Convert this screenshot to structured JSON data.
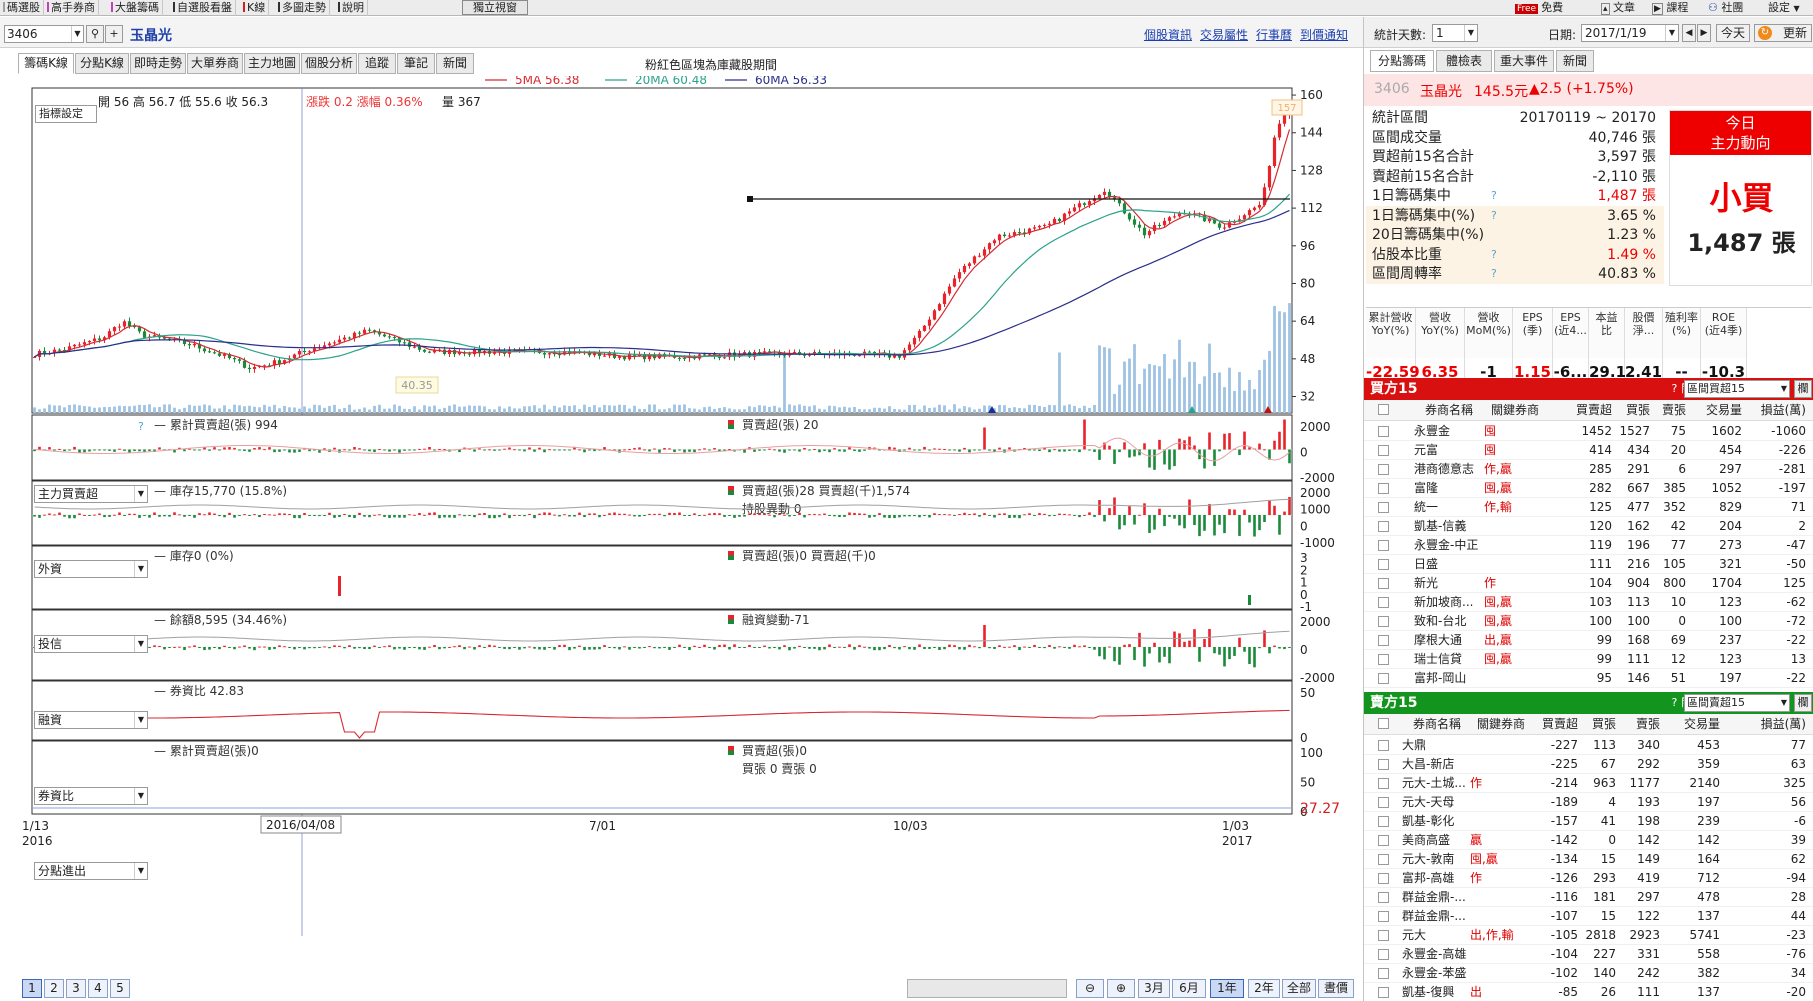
{
  "colors": {
    "up": "#e8232a",
    "down": "#1a8a3a",
    "vol": "#9ec3e3",
    "ma5": "#d62a32",
    "ma20": "#2aa38a",
    "ma60": "#2a2f8a",
    "buyHeader": "#d81010",
    "sellHeader": "#12941e",
    "netLine": "#e8a0a0",
    "invLine": "#a0a0a0"
  },
  "topbar": {
    "items": [
      {
        "label": "碼選股",
        "mark": "#a0a0a0"
      },
      {
        "label": "高手券商",
        "mark": "#c040c0"
      },
      {
        "label": "大盤籌碼",
        "mark": "#c040c0"
      },
      {
        "label": "自選股看盤",
        "mark": "#303030"
      },
      {
        "label": "K線",
        "mark": "#d02020"
      },
      {
        "label": "多圖走勢",
        "mark": "#303030"
      },
      {
        "label": "說明",
        "mark": "#303030"
      }
    ],
    "independent": "獨立視窗",
    "free_badge": "Free",
    "free": "免費",
    "article": "文章",
    "course": "課程",
    "community": "社團",
    "settings": "設定"
  },
  "stock": {
    "code": "3406",
    "name": "玉晶光"
  },
  "links": [
    "個股資訊",
    "交易屬性",
    "行事曆",
    "到價通知"
  ],
  "tabs": [
    "籌碼K線",
    "分點K線",
    "即時走勢",
    "大單券商",
    "主力地圖",
    "個股分析",
    "追蹤",
    "筆記",
    "新聞"
  ],
  "note": "粉紅色區塊為庫藏股期間",
  "legend": {
    "ma5": "5MA 56.38",
    "ma20": "20MA 60.48",
    "ma60": "60MA 56.33"
  },
  "info": {
    "button": "指標設定",
    "ohlc": "開 56  高 56.7  低 55.6  收 56.3",
    "change": "漲跌 0.2  漲幅  0.36%",
    "vol": "量 367",
    "low_marker": "40.35",
    "high_marker": "157"
  },
  "kchart": {
    "yticks": [
      "160",
      "144",
      "128",
      "112",
      "96",
      "80",
      "64",
      "48",
      "32"
    ],
    "priceMin": 25,
    "priceMax": 163,
    "volMax": 1.0
  },
  "panels": [
    {
      "select": "主力買賣超",
      "left": "累計買賣超(張) 994",
      "mid": "買賣超(張) 20",
      "mid2": "",
      "axis": [
        "2000",
        "0",
        "-2000"
      ],
      "kind": "net",
      "line": "#e8a0a0"
    },
    {
      "select": "外資",
      "left": "庫存15,770 (15.8%)",
      "mid": "買賣超(張)28 買賣超(千)1,574",
      "mid2": "持股異動 0",
      "axis": [
        "2000",
        "1000",
        "0",
        "-1000"
      ],
      "kind": "foreign",
      "line": "#a0a0a0"
    },
    {
      "select": "投信",
      "left": "庫存0 (0%)",
      "mid": "買賣超(張)0 買賣超(千)0",
      "mid2": "",
      "axis": [
        "3",
        "2",
        "1",
        "0",
        "-1"
      ],
      "kind": "trust",
      "line": ""
    },
    {
      "select": "融資",
      "left": "餘額8,595 (34.46%)",
      "mid": "融資變動-71",
      "mid2": "",
      "axis": [
        "2000",
        "0",
        "-2000"
      ],
      "kind": "margin",
      "line": "#a0a0a0"
    },
    {
      "select": "券資比",
      "left": "券資比 42.83",
      "mid": "",
      "mid2": "",
      "axis": [
        "50",
        "0"
      ],
      "kind": "ratio",
      "line": "#d62a32"
    },
    {
      "select": "分點進出",
      "left": "累計買賣超(張)0",
      "mid": "買賣超(張)0",
      "mid2": "買張 0 賣張 0",
      "axis": [
        "100",
        "50",
        "0"
      ],
      "kind": "flat",
      "line": ""
    }
  ],
  "lastValue": "27.27",
  "xaxis": [
    {
      "label": "1/13",
      "sub": "2016"
    },
    {
      "label": "2016/04/08",
      "sub": ""
    },
    {
      "label": "7/01",
      "sub": ""
    },
    {
      "label": "10/03",
      "sub": ""
    },
    {
      "label": "1/03",
      "sub": "2017"
    }
  ],
  "bottom": {
    "pages": [
      "1",
      "2",
      "3",
      "4",
      "5"
    ],
    "ranges": [
      "3月",
      "6月",
      "1年",
      "2年",
      "全部",
      "晝價"
    ]
  },
  "right": {
    "days_label": "統計天數:",
    "days": "1",
    "date_label": "日期:",
    "date": "2017/1/19",
    "today_btn": "今天",
    "refresh_btn": "更新",
    "tabs": [
      "分點籌碼",
      "體檢表",
      "重大事件",
      "新聞"
    ],
    "quote": {
      "code": "3406",
      "name": "玉晶光",
      "price": "145.5元",
      "chg": "▲2.5 (+1.75%)"
    },
    "stats": [
      {
        "label": "統計區間",
        "value": "20170119 ~ 20170",
        "q": false,
        "red": false
      },
      {
        "label": "區間成交量",
        "value": "40,746 張",
        "q": false,
        "red": false
      },
      {
        "label": "買超前15名合計",
        "value": "3,597 張",
        "q": false,
        "red": false
      },
      {
        "label": "賣超前15名合計",
        "value": "-2,110 張",
        "q": false,
        "red": false
      },
      {
        "label": "1日籌碼集中",
        "value": "1,487 張",
        "q": true,
        "red": true
      },
      {
        "label": "1日籌碼集中(%)",
        "value": "3.65 %",
        "q": true,
        "red": false
      },
      {
        "label": "20日籌碼集中(%)",
        "value": "1.23 %",
        "q": false,
        "red": false
      },
      {
        "label": "佔股本比重",
        "value": "1.49 %",
        "q": true,
        "red": true
      },
      {
        "label": "區間周轉率",
        "value": "40.83 %",
        "q": true,
        "red": false
      }
    ],
    "today": {
      "title1": "今日",
      "title2": "主力動向",
      "action": "小買",
      "volume": "1,487 張"
    },
    "matrix": [
      {
        "h": "累計營收\nYoY(%)",
        "v": "-22.59",
        "c": "#e00"
      },
      {
        "h": "營收\nYoY(%)",
        "v": "6.35",
        "c": "#e00"
      },
      {
        "h": "營收\nMoM(%)",
        "v": "-1",
        "c": "#111"
      },
      {
        "h": "EPS\n(季)",
        "v": "1.15",
        "c": "#e00"
      },
      {
        "h": "EPS\n(近4...",
        "v": "-6...",
        "c": "#111"
      },
      {
        "h": "本益\n比",
        "v": "29.1",
        "c": "#111"
      },
      {
        "h": "股價\n淨...",
        "v": "2.41",
        "c": "#111"
      },
      {
        "h": "殖利率\n(%)",
        "v": "--",
        "c": "#111"
      },
      {
        "h": "ROE\n(近4季)",
        "v": "-10.3",
        "c": "#111"
      }
    ],
    "buy": {
      "title": "買方15",
      "key_label": "關鍵券商:",
      "select": "區間買超15",
      "headers": [
        "券商名稱",
        "關鍵券商",
        "買賣超",
        "買張",
        "賣張",
        "交易量",
        "損益(萬)"
      ],
      "rows": [
        [
          "永豐金",
          "囤",
          "1452",
          "1527",
          "75",
          "1602",
          "-1060"
        ],
        [
          "元富",
          "囤",
          "414",
          "434",
          "20",
          "454",
          "-226"
        ],
        [
          "港商德意志",
          "作,贏",
          "285",
          "291",
          "6",
          "297",
          "-281"
        ],
        [
          "富隆",
          "囤,贏",
          "282",
          "667",
          "385",
          "1052",
          "-197"
        ],
        [
          "統一",
          "作,輸",
          "125",
          "477",
          "352",
          "829",
          "71"
        ],
        [
          "凱基-信義",
          "",
          "120",
          "162",
          "42",
          "204",
          "2"
        ],
        [
          "永豐金-中正",
          "",
          "119",
          "196",
          "77",
          "273",
          "-47"
        ],
        [
          "日盛",
          "",
          "111",
          "216",
          "105",
          "321",
          "-50"
        ],
        [
          "新光",
          "作",
          "104",
          "904",
          "800",
          "1704",
          "125"
        ],
        [
          "新加坡商...",
          "囤,贏",
          "103",
          "113",
          "10",
          "123",
          "-62"
        ],
        [
          "致和-台北",
          "囤,贏",
          "100",
          "100",
          "0",
          "100",
          "-72"
        ],
        [
          "摩根大通",
          "出,贏",
          "99",
          "168",
          "69",
          "237",
          "-22"
        ],
        [
          "瑞士信貸",
          "囤,贏",
          "99",
          "111",
          "12",
          "123",
          "13"
        ],
        [
          "富邦-岡山",
          "",
          "95",
          "146",
          "51",
          "197",
          "-22"
        ]
      ]
    },
    "sell": {
      "title": "賣方15",
      "key_label": "關鍵券商:",
      "select": "區間賣超15",
      "headers": [
        "券商名稱",
        "關鍵券商",
        "買賣超",
        "買張",
        "賣張",
        "交易量",
        "損益(萬)"
      ],
      "rows": [
        [
          "大鼎",
          "",
          "-227",
          "113",
          "340",
          "453",
          "77"
        ],
        [
          "大昌-新店",
          "",
          "-225",
          "67",
          "292",
          "359",
          "63"
        ],
        [
          "元大-土城...",
          "作",
          "-214",
          "963",
          "1177",
          "2140",
          "325"
        ],
        [
          "元大-天母",
          "",
          "-189",
          "4",
          "193",
          "197",
          "56"
        ],
        [
          "凱基-彰化",
          "",
          "-157",
          "41",
          "198",
          "239",
          "-6"
        ],
        [
          "美商高盛",
          "贏",
          "-142",
          "0",
          "142",
          "142",
          "39"
        ],
        [
          "元大-敦南",
          "囤,贏",
          "-134",
          "15",
          "149",
          "164",
          "62"
        ],
        [
          "富邦-高雄",
          "作",
          "-126",
          "293",
          "419",
          "712",
          "-94"
        ],
        [
          "群益金鼎-...",
          "",
          "-116",
          "181",
          "297",
          "478",
          "28"
        ],
        [
          "群益金鼎-...",
          "",
          "-107",
          "15",
          "122",
          "137",
          "44"
        ],
        [
          "元大",
          "出,作,輸",
          "-105",
          "2818",
          "2923",
          "5741",
          "-23"
        ],
        [
          "永豐金-高雄",
          "",
          "-104",
          "227",
          "331",
          "558",
          "-76"
        ],
        [
          "永豐金-苯盛",
          "",
          "-102",
          "140",
          "242",
          "382",
          "34"
        ],
        [
          "凱基-復興",
          "出",
          "-85",
          "26",
          "111",
          "137",
          "-20"
        ]
      ]
    }
  }
}
